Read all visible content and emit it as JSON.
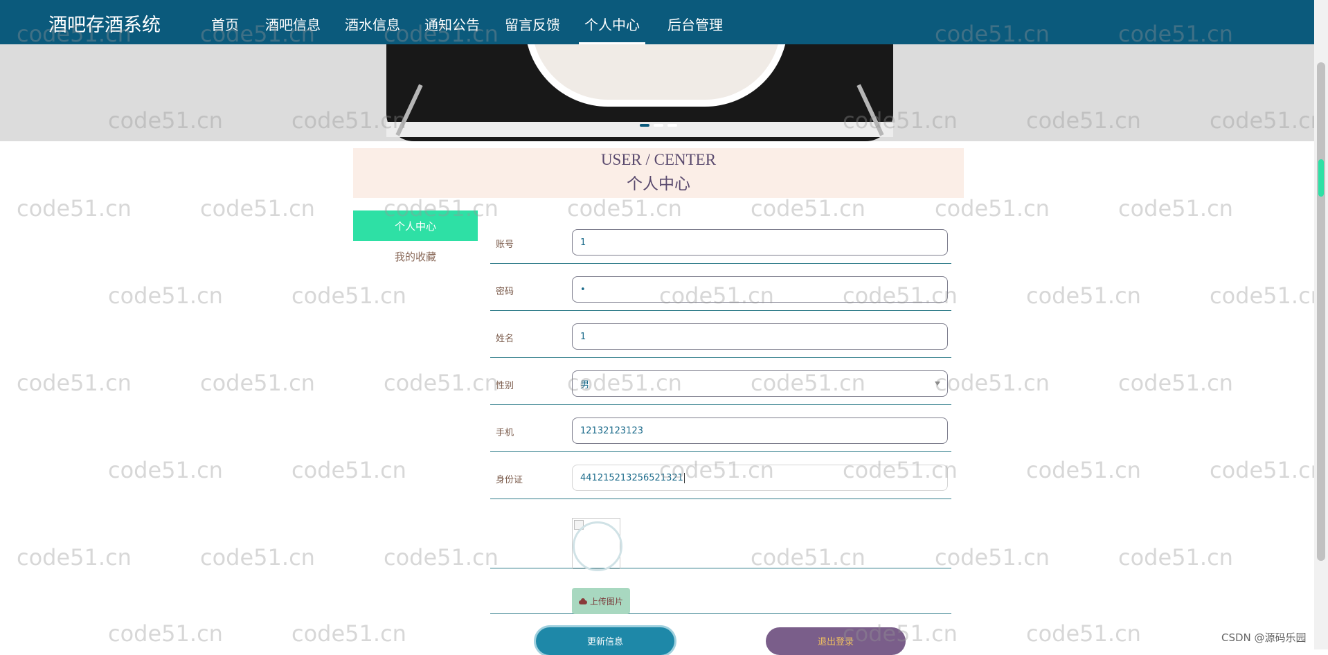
{
  "nav": {
    "brand": "酒吧存酒系统",
    "items": [
      "首页",
      "酒吧信息",
      "酒水信息",
      "通知公告",
      "留言反馈",
      "个人中心",
      "后台管理"
    ],
    "active_index": 5
  },
  "banner": {
    "slide_count": 3,
    "active_slide": 1
  },
  "title": {
    "en": "USER / CENTER",
    "cn": "个人中心"
  },
  "sidebar": {
    "items": [
      "个人中心",
      "我的收藏"
    ],
    "active_index": 0
  },
  "form": {
    "account": {
      "label": "账号",
      "value": "1"
    },
    "password": {
      "label": "密码",
      "value": "•"
    },
    "name": {
      "label": "姓名",
      "value": "1"
    },
    "gender": {
      "label": "性别",
      "value": "男"
    },
    "phone": {
      "label": "手机",
      "value": "12132123123"
    },
    "id_card": {
      "label": "身份证",
      "value": "441215213256521321"
    },
    "upload_label": "上传图片"
  },
  "buttons": {
    "update": "更新信息",
    "logout": "退出登录"
  },
  "watermark": "code51.cn",
  "csdn_mark": "CSDN @源码乐园",
  "colors": {
    "nav_bg": "#0b5a7c",
    "sidebar_active": "#2ee0a5",
    "title_bg": "#fbeee7",
    "update_btn": "#1e88a8",
    "logout_btn": "#7a5e8a"
  }
}
